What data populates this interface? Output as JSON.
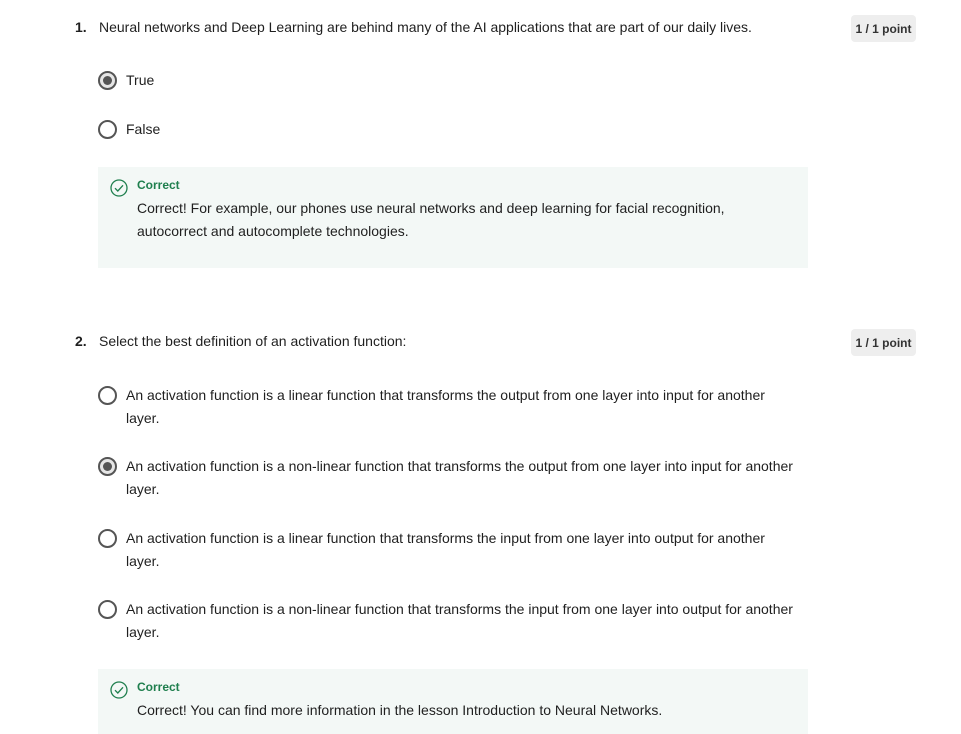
{
  "questions": [
    {
      "number": "1.",
      "text": "Neural networks and Deep Learning are behind many of the AI applications that are part of our daily lives.",
      "points": "1 / 1 point",
      "options": [
        {
          "label": "True",
          "checked": true
        },
        {
          "label": "False",
          "checked": false
        }
      ],
      "feedback": {
        "title": "Correct",
        "text": "Correct! For example, our phones use neural networks and deep learning for facial recognition, autocorrect and autocomplete technologies."
      }
    },
    {
      "number": "2.",
      "text": "Select the best definition of an activation function:",
      "points": "1 / 1 point",
      "options": [
        {
          "label": "An activation function is a linear function that transforms the output from one layer into input for another layer.",
          "checked": false
        },
        {
          "label": "An activation function is a non-linear function that transforms the output from one layer into input for another layer.",
          "checked": true
        },
        {
          "label": "An activation function is a linear function that transforms the input from one layer into output for another layer.",
          "checked": false
        },
        {
          "label": "An activation function is a non-linear function that transforms the input from one layer into output for another layer.",
          "checked": false
        }
      ],
      "feedback": {
        "title": "Correct",
        "text": "Correct! You can find more information in the lesson Introduction to Neural Networks."
      }
    }
  ],
  "colors": {
    "correct": "#1f7f4e",
    "feedback_bg": "#f3f8f6",
    "points_bg": "#eeeeee"
  }
}
